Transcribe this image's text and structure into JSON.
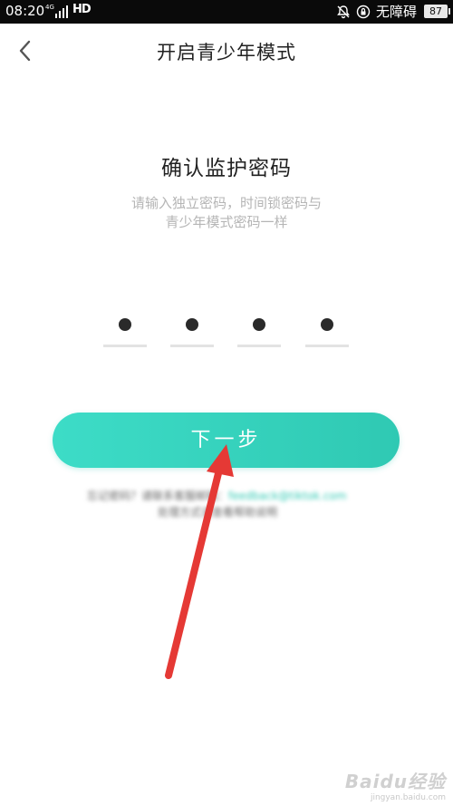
{
  "status_bar": {
    "time": "08:20",
    "network": "4G",
    "hd": "HD",
    "label": "无障碍",
    "battery": "87"
  },
  "header": {
    "title": "开启青少年模式"
  },
  "content": {
    "heading": "确认监护密码",
    "subtext_line1": "请输入独立密码，时间锁密码与",
    "subtext_line2": "青少年模式密码一样",
    "code_length": 4,
    "filled_digits": 4
  },
  "next_button": {
    "label": "下一步"
  },
  "forgot": {
    "line1": "忘记密码？请联系客服邮箱：",
    "link": "feedback@tiktok.com",
    "line2": "处理方式请查看帮助说明"
  },
  "colors": {
    "accent": "#2fc9b3",
    "arrow": "#e53935",
    "status_bar_bg": "#0a0a0a"
  },
  "watermark": {
    "logo": "Baidu经验",
    "url": "jingyan.baidu.com"
  }
}
